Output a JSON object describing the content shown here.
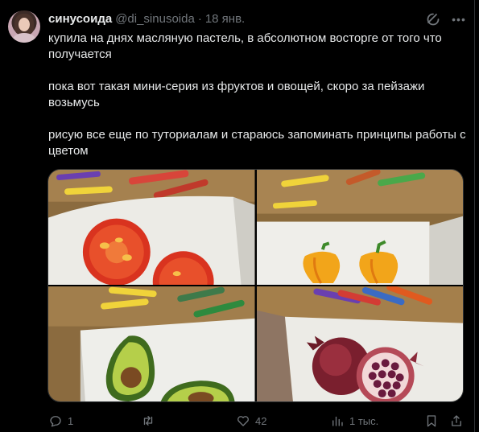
{
  "tweet": {
    "author_name": "синусоида",
    "author_handle": "@di_sinusoida",
    "separator": "·",
    "date": "18 янв.",
    "text_lines": {
      "p1": "купила на днях масляную пастель, в абсолютном восторге от того что получается",
      "p2": "пока вот такая мини-серия из фруктов и овощей, скоро за пейзажи возьмусь",
      "p3": "рисую все еще по туториалам и стараюсь запоминать принципы работы с цветом"
    },
    "images": [
      "tomato-drawing",
      "bell-pepper-drawing",
      "avocado-drawing",
      "pomegranate-drawing"
    ],
    "actions": {
      "reply_count": "1",
      "repost_count": "",
      "like_count": "42",
      "views_count": "1 тыс."
    }
  },
  "icons": [
    "grok-icon",
    "more-icon",
    "reply-icon",
    "repost-icon",
    "like-icon",
    "views-icon",
    "bookmark-icon",
    "share-icon"
  ],
  "colors": {
    "background": "#000000",
    "text": "#e7e9ea",
    "muted": "#71767b",
    "border": "#2f3336"
  }
}
